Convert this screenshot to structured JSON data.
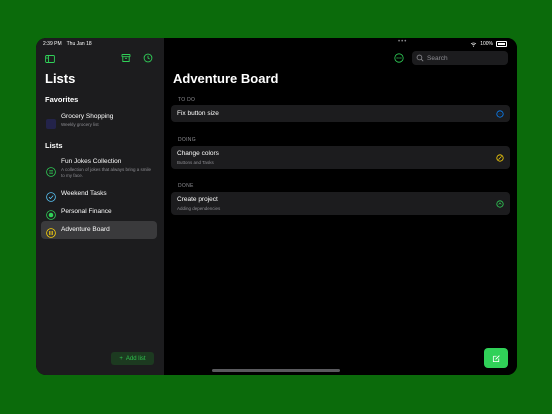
{
  "status": {
    "time": "2:39 PM",
    "date": "Thu Jan 18",
    "dots": "•••",
    "battery": "100%"
  },
  "sidebar": {
    "title": "Lists",
    "favorites_header": "Favorites",
    "favorites": [
      {
        "label": "Grocery Shopping",
        "subtitle": "Weekly grocery list"
      }
    ],
    "lists_header": "Lists",
    "lists": [
      {
        "label": "Fun Jokes Collection",
        "subtitle": "A collection of jokes that always bring a smile to my face."
      },
      {
        "label": "Weekend Tasks"
      },
      {
        "label": "Personal Finance"
      },
      {
        "label": "Adventure Board"
      }
    ],
    "add_list": "Add list"
  },
  "main": {
    "title": "Adventure Board",
    "search_placeholder": "Search",
    "groups": [
      {
        "header": "TO DO",
        "items": [
          {
            "title": "Fix button size",
            "subtitle": ""
          }
        ]
      },
      {
        "header": "DOING",
        "items": [
          {
            "title": "Change colors",
            "subtitle": "Buttons and Tasks"
          }
        ]
      },
      {
        "header": "DONE",
        "items": [
          {
            "title": "Create project",
            "subtitle": "Adding dependencies"
          }
        ]
      }
    ]
  },
  "colors": {
    "accent": "#30d158",
    "todo": "#0a84ff",
    "doing": "#ffd60a",
    "done": "#30d158"
  }
}
